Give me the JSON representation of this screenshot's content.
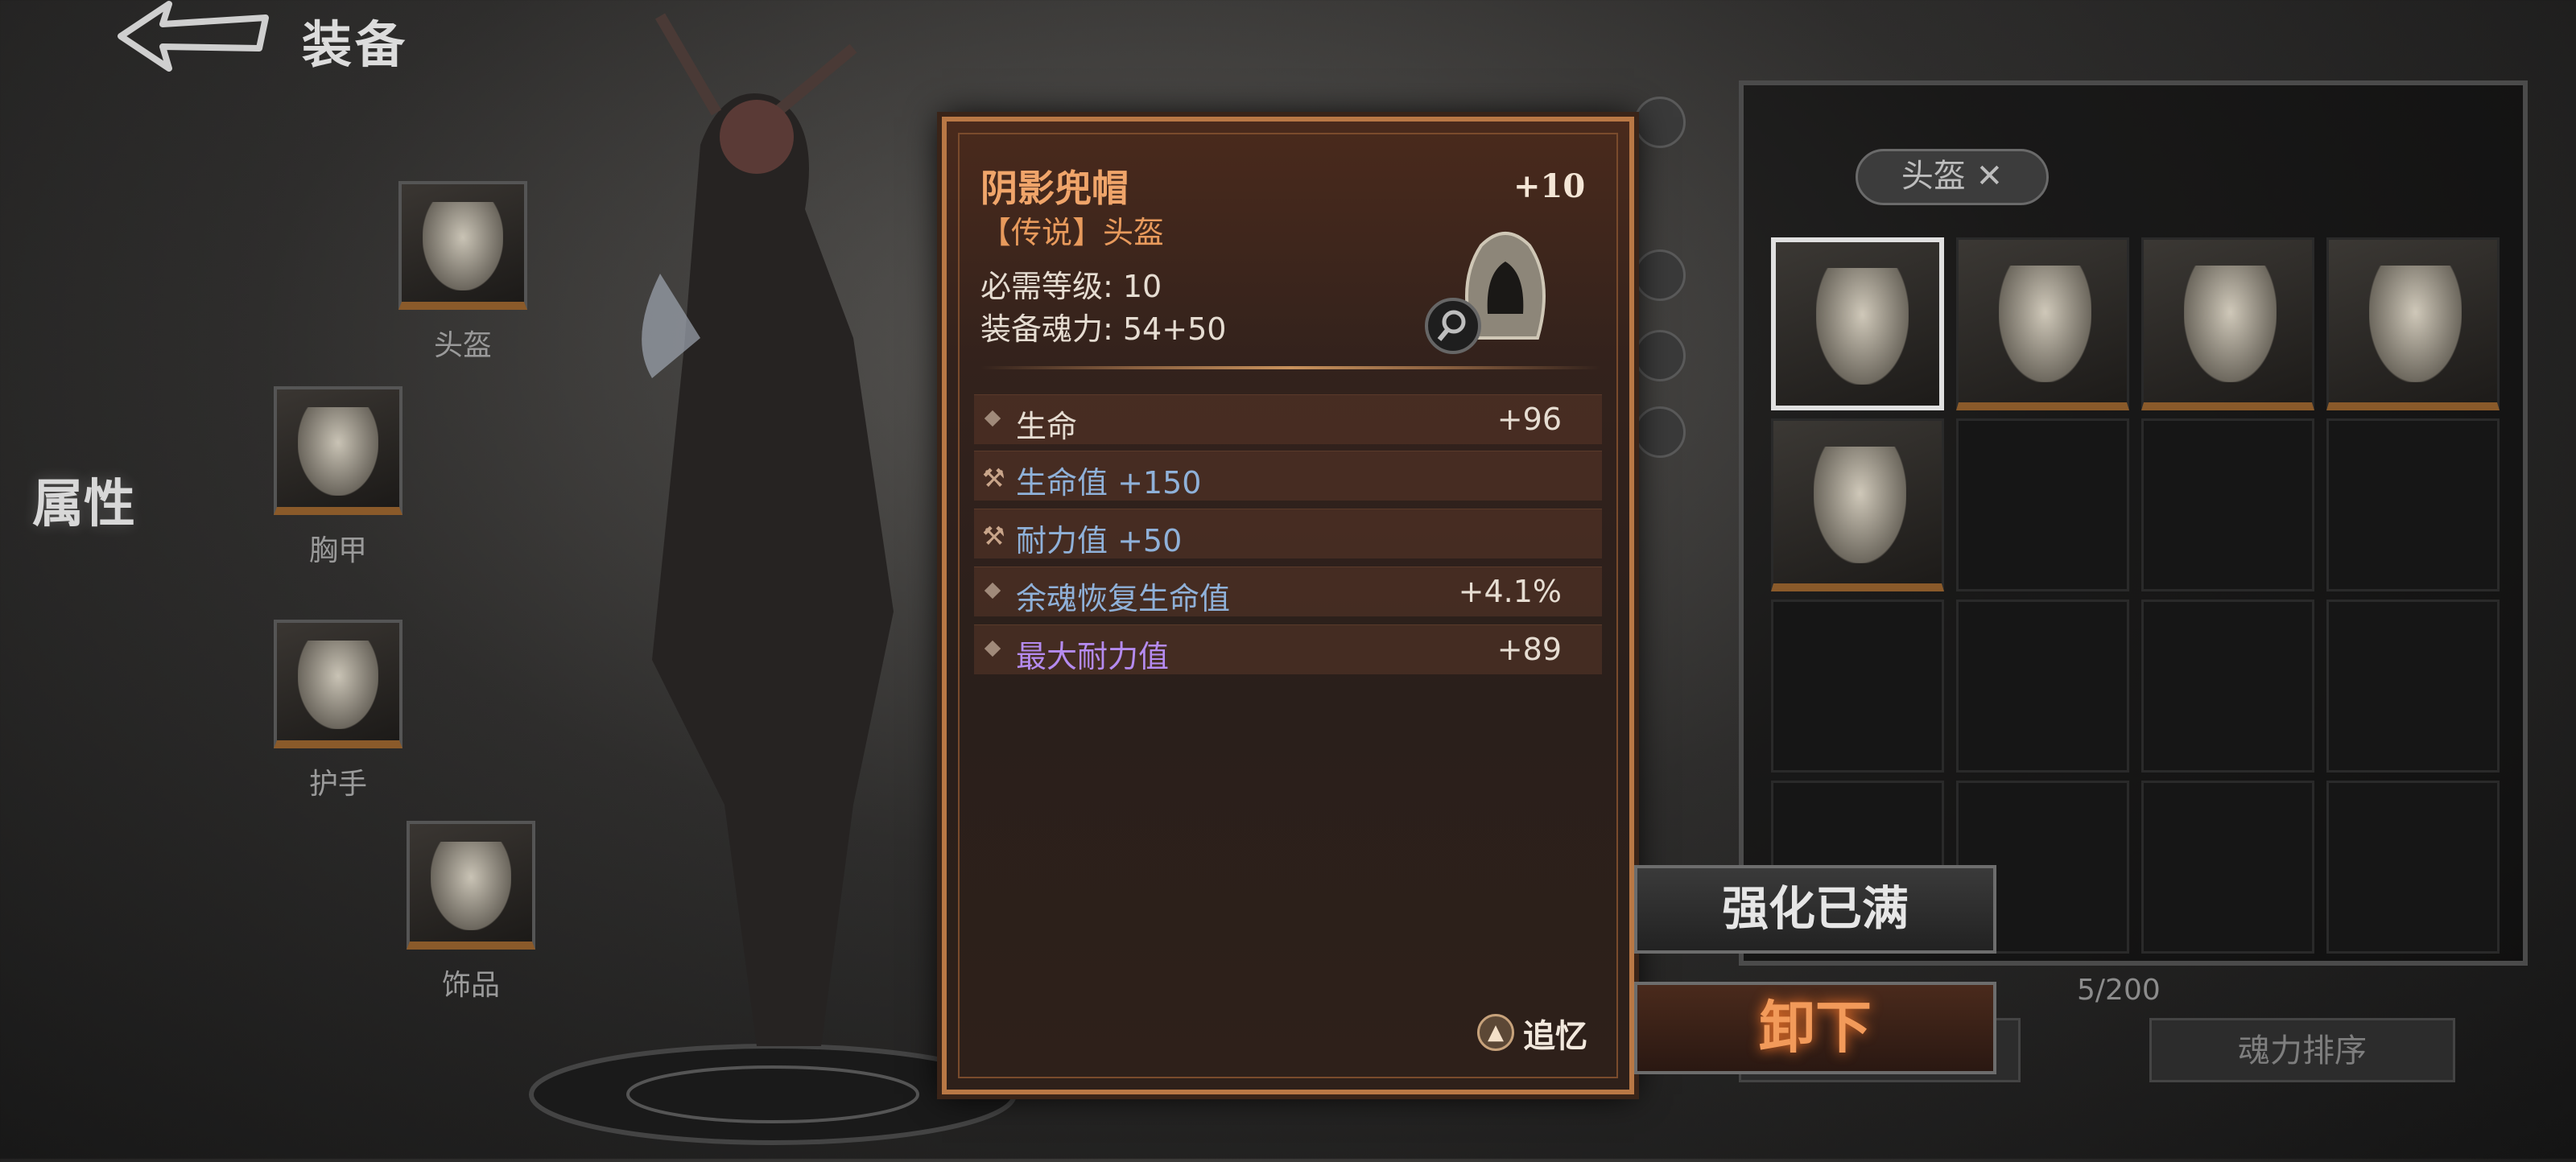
{
  "header": {
    "title": "装备"
  },
  "left_panel": {
    "attr_tab": "属性",
    "slots": [
      {
        "label": "头盔"
      },
      {
        "label": "胸甲"
      },
      {
        "label": "护手"
      },
      {
        "label": "饰品"
      }
    ]
  },
  "item_card": {
    "name": "阴影兜帽",
    "enhance_level": "+10",
    "rarity": "【传说】头盔",
    "required_level": "必需等级:  10",
    "soul_power": "装备魂力:  54+50",
    "stats": [
      {
        "type": "base",
        "name": "生命",
        "value": "+96",
        "name_color": "#e6ddd2"
      },
      {
        "type": "forged",
        "name": "生命值 +150",
        "value": "",
        "name_color": "#8fb1d9"
      },
      {
        "type": "forged",
        "name": "耐力值 +50",
        "value": "",
        "name_color": "#8fb1d9"
      },
      {
        "type": "base",
        "name": "余魂恢复生命值",
        "value": "+4.1%",
        "name_color": "#8fb1d9"
      },
      {
        "type": "base",
        "name": "最大耐力值",
        "value": "+89",
        "name_color": "#b58bf0"
      }
    ],
    "recall_label": "追忆"
  },
  "actions": {
    "enhance_full": "强化已满",
    "unequip": "卸下"
  },
  "inventory": {
    "filter_label": "头盔 ✕",
    "filled_count": 5,
    "capacity": "5/200",
    "soul_button": "魂力排序"
  },
  "colors": {
    "accent_orange": "#f0a56a",
    "card_border": "#b97845",
    "forged_stat": "#8fb1d9",
    "rare_stat": "#b58bf0"
  }
}
